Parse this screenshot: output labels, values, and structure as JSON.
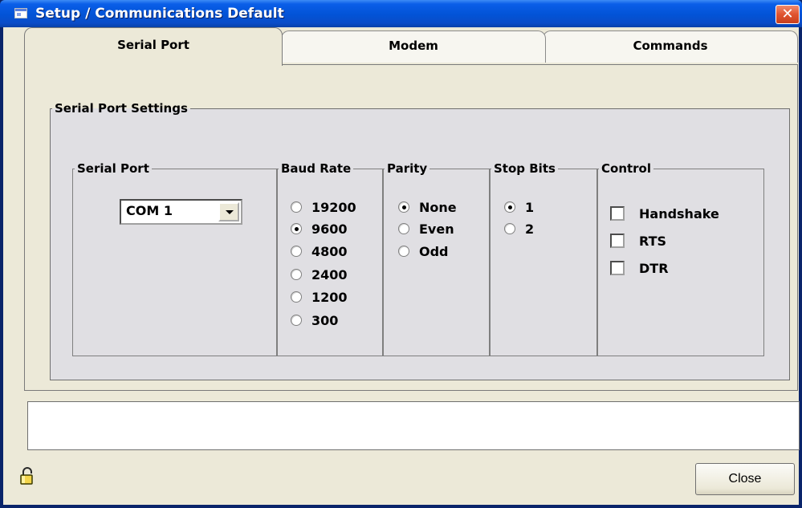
{
  "window": {
    "title": "Setup / Communications Default",
    "close_glyph": "✕"
  },
  "tabs": [
    {
      "label": "Serial Port",
      "active": true
    },
    {
      "label": "Modem",
      "active": false
    },
    {
      "label": "Commands",
      "active": false
    }
  ],
  "serial_settings": {
    "group_label": "Serial Port Settings",
    "serial_port": {
      "label": "Serial Port",
      "selected": "COM 1"
    },
    "baud_rate": {
      "label": "Baud Rate",
      "options": [
        "19200",
        "9600",
        "4800",
        "2400",
        "1200",
        "300"
      ],
      "selected": "9600"
    },
    "parity": {
      "label": "Parity",
      "options": [
        "None",
        "Even",
        "Odd"
      ],
      "selected": "None"
    },
    "stop_bits": {
      "label": "Stop Bits",
      "options": [
        "1",
        "2"
      ],
      "selected": "1"
    },
    "control": {
      "label": "Control",
      "options": [
        {
          "label": "Handshake",
          "checked": false
        },
        {
          "label": "RTS",
          "checked": false
        },
        {
          "label": "DTR",
          "checked": false
        }
      ]
    }
  },
  "status": {
    "text": ""
  },
  "footer": {
    "close_label": "Close",
    "lock_icon": "lock-icon"
  },
  "colors": {
    "titlebar": "#0253d6",
    "client_bg": "#ece9d8",
    "group_bg": "#e0dfe3",
    "close_x": "#e0542f"
  }
}
